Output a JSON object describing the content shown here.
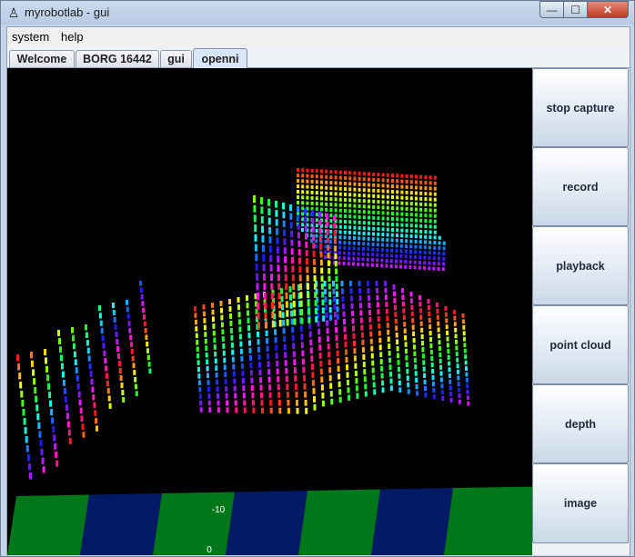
{
  "window": {
    "title": "myrobotlab - gui",
    "app_icon": "robot-icon"
  },
  "titlebar_buttons": {
    "minimize": "—",
    "maximize": "☐",
    "close": "✕"
  },
  "menu": [
    "system",
    "help"
  ],
  "tabs": [
    {
      "label": "Welcome",
      "selected": false
    },
    {
      "label": "BORG 16442",
      "selected": false
    },
    {
      "label": "gui",
      "selected": false
    },
    {
      "label": "openni",
      "selected": true
    }
  ],
  "viewport": {
    "axis_labels": [
      "-10",
      "0"
    ],
    "floor_colors": [
      "#00781a",
      "#001a66"
    ]
  },
  "sidebar": {
    "buttons": [
      "stop capture",
      "record",
      "playback",
      "point cloud",
      "depth",
      "image"
    ]
  }
}
